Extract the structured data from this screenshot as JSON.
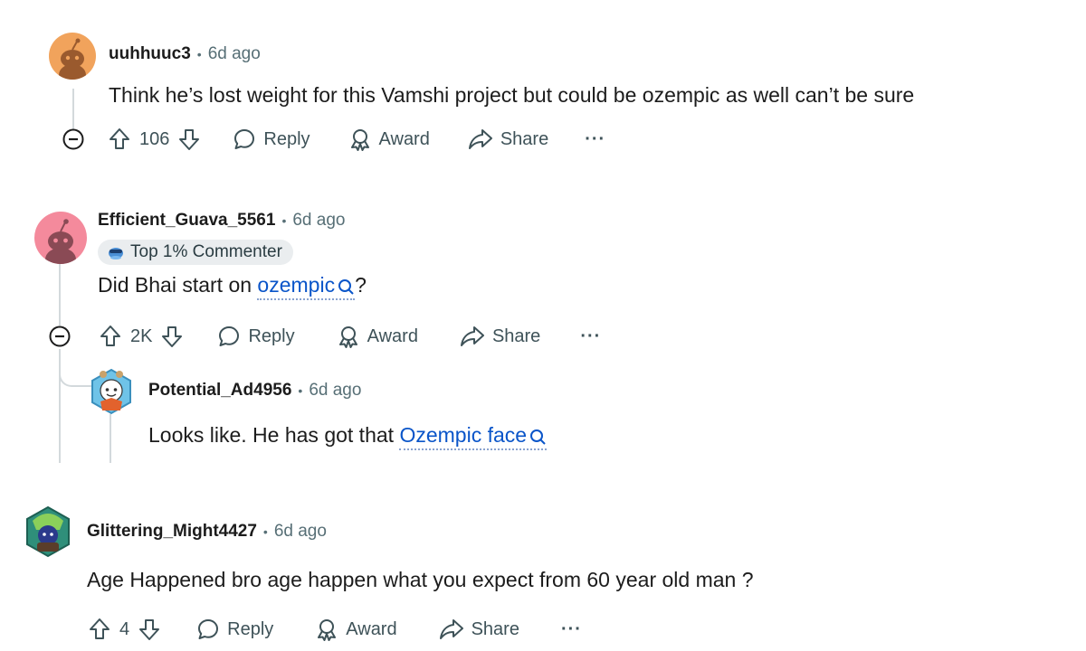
{
  "comments": [
    {
      "username": "uuhhuuc3",
      "time": "6d ago",
      "text": "Think he’s lost weight for this Vamshi project but could be ozempic as well can’t be sure",
      "score": "106"
    },
    {
      "username": "Efficient_Guava_5561",
      "time": "6d ago",
      "flair": "Top 1% Commenter",
      "text_before": "Did Bhai start on",
      "link": "ozempic",
      "text_after": "?",
      "score": "2K"
    },
    {
      "username": "Potential_Ad4956",
      "time": "6d ago",
      "text_before": "Looks like. He has got that",
      "link": "Ozempic face"
    },
    {
      "username": "Glittering_Might4427",
      "time": "6d ago",
      "text": "Age Happened bro age happen what you expect from 60 year old man ?",
      "score": "4"
    }
  ],
  "labels": {
    "dot": "•",
    "reply": "Reply",
    "award": "Award",
    "share": "Share",
    "more": "···"
  },
  "colors": {
    "avatar1": "#f1a35c",
    "avatar2": "#f48a9c",
    "link": "#0a55c9",
    "meta": "#576f76"
  },
  "icons": [
    "collapse-icon",
    "upvote-icon",
    "downvote-icon",
    "reply-icon",
    "award-icon",
    "share-icon",
    "more-icon",
    "search-icon",
    "flair-icon"
  ]
}
